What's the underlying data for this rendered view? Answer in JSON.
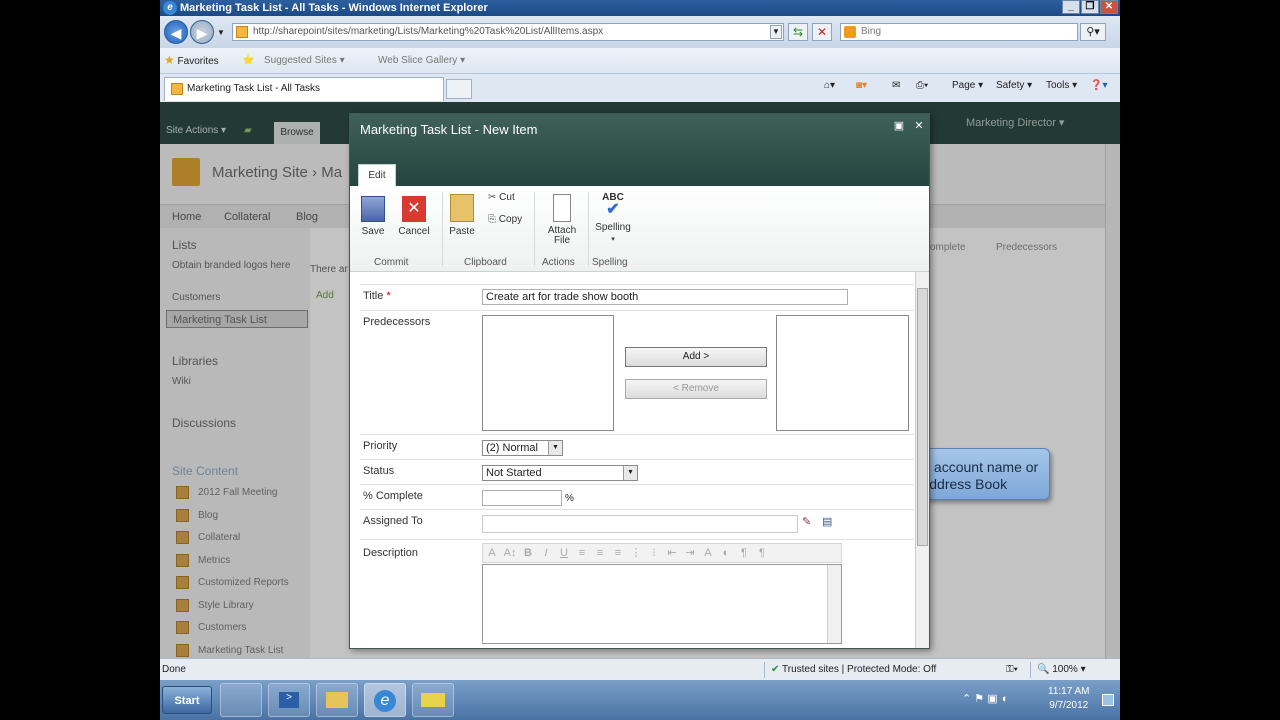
{
  "window": {
    "title": "Marketing Task List - All Tasks - Windows Internet Explorer"
  },
  "address": {
    "url": "http://sharepoint/sites/marketing/Lists/Marketing%20Task%20List/AllItems.aspx",
    "search_placeholder": "Bing"
  },
  "favorites": {
    "favorites_label": "Favorites",
    "suggested": "Suggested Sites ▾",
    "slice": "Web Slice Gallery ▾"
  },
  "tabs": {
    "active": "Marketing Task List - All Tasks"
  },
  "commandbar": {
    "page": "Page ▾",
    "safety": "Safety ▾",
    "tools": "Tools ▾"
  },
  "sharepoint": {
    "site_actions": "Site Actions ▾",
    "browse": "Browse",
    "user": "Marketing Director ▾",
    "site_title": "Marketing Site › Ma",
    "nav": [
      "Home",
      "Collateral",
      "Blog"
    ],
    "right_cols": [
      "omplete",
      "Predecessors"
    ],
    "left": {
      "lists_header": "Lists",
      "lists": [
        "Obtain branded logos here",
        "Customers",
        "Marketing Task List"
      ],
      "libraries_header": "Libraries",
      "libraries": [
        "Wiki"
      ],
      "discussions_header": "Discussions",
      "site_content_header": "Site Content",
      "site_content": [
        "2012 Fall Meeting",
        "Blog",
        "Collateral",
        "Metrics",
        "Customized Reports",
        "Style Library",
        "Customers",
        "Marketing Task List"
      ]
    },
    "partial_there": "There ar",
    "partial_add": "Add"
  },
  "dialog": {
    "title": "Marketing Task List - New Item",
    "tab": "Edit",
    "ribbon": {
      "save": "Save",
      "cancel": "Cancel",
      "paste": "Paste",
      "cut": "Cut",
      "copy": "Copy",
      "attach_file": "Attach File",
      "spelling": "Spelling",
      "groups": [
        "Commit",
        "Clipboard",
        "Actions",
        "Spelling"
      ]
    },
    "form": {
      "title_label": "Title",
      "title_value": "Create art for trade show booth",
      "predecessors_label": "Predecessors",
      "add_button": "Add >",
      "remove_button": "< Remove",
      "priority_label": "Priority",
      "priority_value": "(2) Normal",
      "status_label": "Status",
      "status_value": "Not Started",
      "percent_label": "% Complete",
      "percent_suffix": "%",
      "assigned_label": "Assigned To",
      "description_label": "Description"
    }
  },
  "callout": {
    "text": "Either type the account name or use the Address Book"
  },
  "statusbar": {
    "left": "Done",
    "zone": "Trusted sites | Protected Mode: Off",
    "zoom": "100%"
  },
  "taskbar": {
    "start": "Start",
    "time": "11:17 AM",
    "date": "9/7/2012"
  }
}
